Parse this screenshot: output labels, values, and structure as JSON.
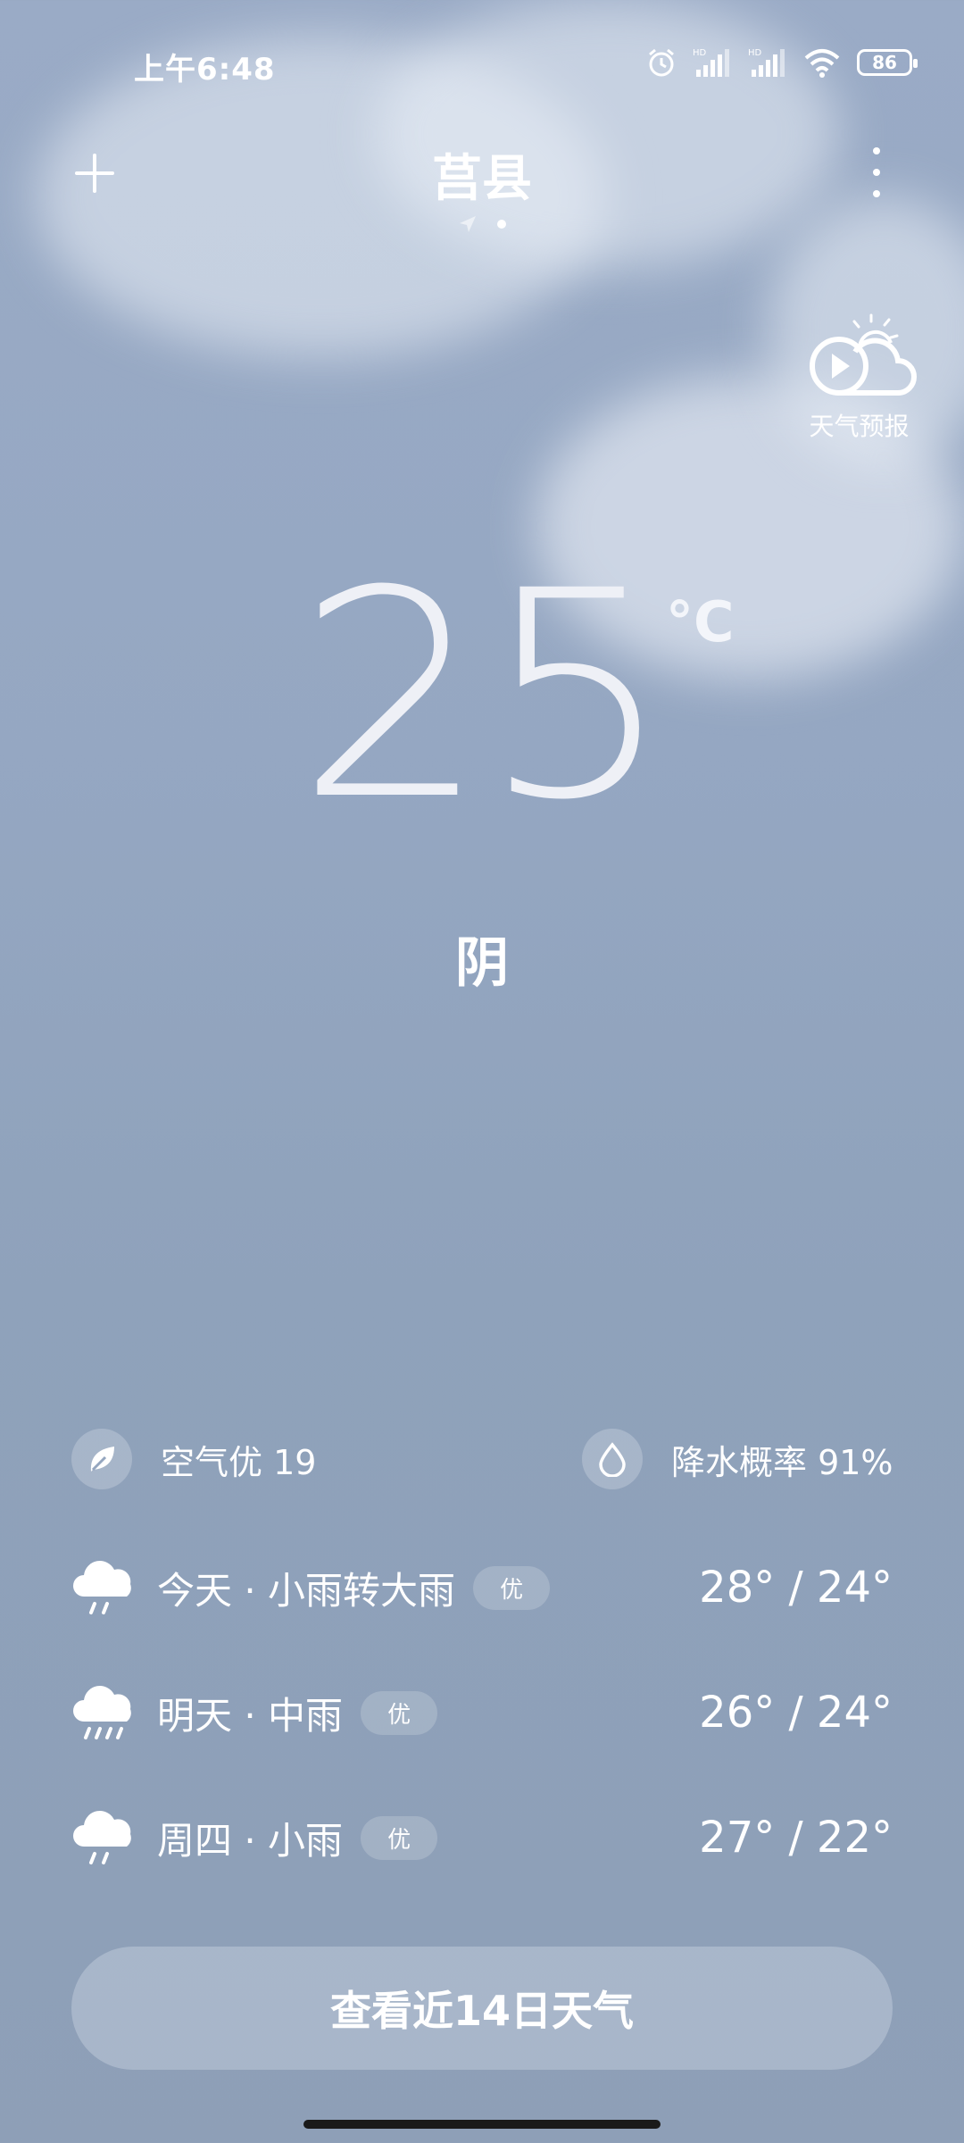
{
  "status_bar": {
    "time": "上午6:48",
    "battery": "86",
    "icons": [
      "alarm-icon",
      "signal-hd-1-icon",
      "signal-hd-2-icon",
      "wifi-icon",
      "battery-icon"
    ]
  },
  "header": {
    "city": "莒县",
    "add_icon": "plus-icon",
    "more_icon": "more-vertical-icon"
  },
  "forecast_video": {
    "label": "天气预报",
    "icon": "play-cloud-icon"
  },
  "current": {
    "temperature": "25",
    "unit": "°C",
    "condition": "阴"
  },
  "info": {
    "air_quality": "空气优 19",
    "precipitation": "降水概率 91%"
  },
  "days": [
    {
      "label": "今天 · 小雨转大雨",
      "aqi": "优",
      "range": "28° / 24°",
      "icon": "light-rain-icon"
    },
    {
      "label": "明天 · 中雨",
      "aqi": "优",
      "range": "26° / 24°",
      "icon": "moderate-rain-icon"
    },
    {
      "label": "周四 · 小雨",
      "aqi": "优",
      "range": "27° / 22°",
      "icon": "light-rain-icon"
    }
  ],
  "button": {
    "label": "查看近14日天气"
  },
  "colors": {
    "background_top": "#9aabc6",
    "background_bottom": "#8e9fb7",
    "text": "#ffffff"
  }
}
